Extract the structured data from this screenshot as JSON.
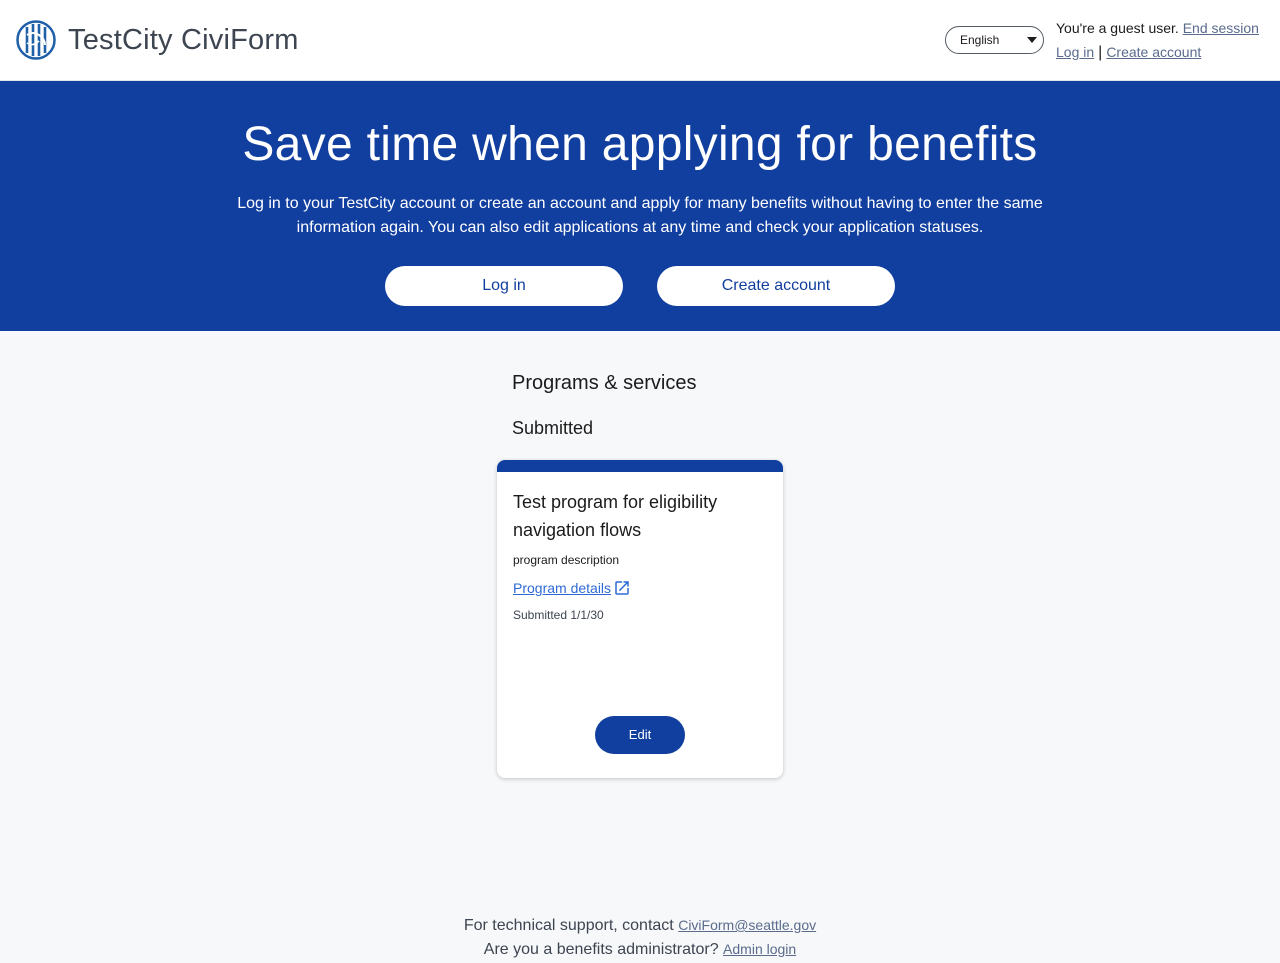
{
  "header": {
    "app_name": "TestCity CiviForm",
    "language": "English",
    "guest_text": "You're a guest user.",
    "end_session": "End session",
    "login": "Log in",
    "separator": "|",
    "create_account": "Create account"
  },
  "hero": {
    "title": "Save time when applying for benefits",
    "description": "Log in to your TestCity account or create an account and apply for many benefits without having to enter the same information again. You can also edit applications at any time and check your application statuses.",
    "login_button": "Log in",
    "create_button": "Create account"
  },
  "main": {
    "section_title": "Programs & services",
    "submitted_heading": "Submitted",
    "card": {
      "title": "Test program for eligibility navigation flows",
      "description": "program description",
      "details_link": "Program details",
      "status": "Submitted 1/1/30",
      "edit_button": "Edit"
    }
  },
  "footer": {
    "support_text": "For technical support, contact",
    "support_email": "CiviForm@seattle.gov",
    "admin_text": "Are you a benefits administrator?",
    "admin_link": "Admin login"
  },
  "colors": {
    "primary": "#113f9f",
    "link": "#5a6b8c",
    "background": "#f7f8fa"
  },
  "icons": [
    "city-logo-icon",
    "chevron-down-icon",
    "external-link-icon"
  ]
}
